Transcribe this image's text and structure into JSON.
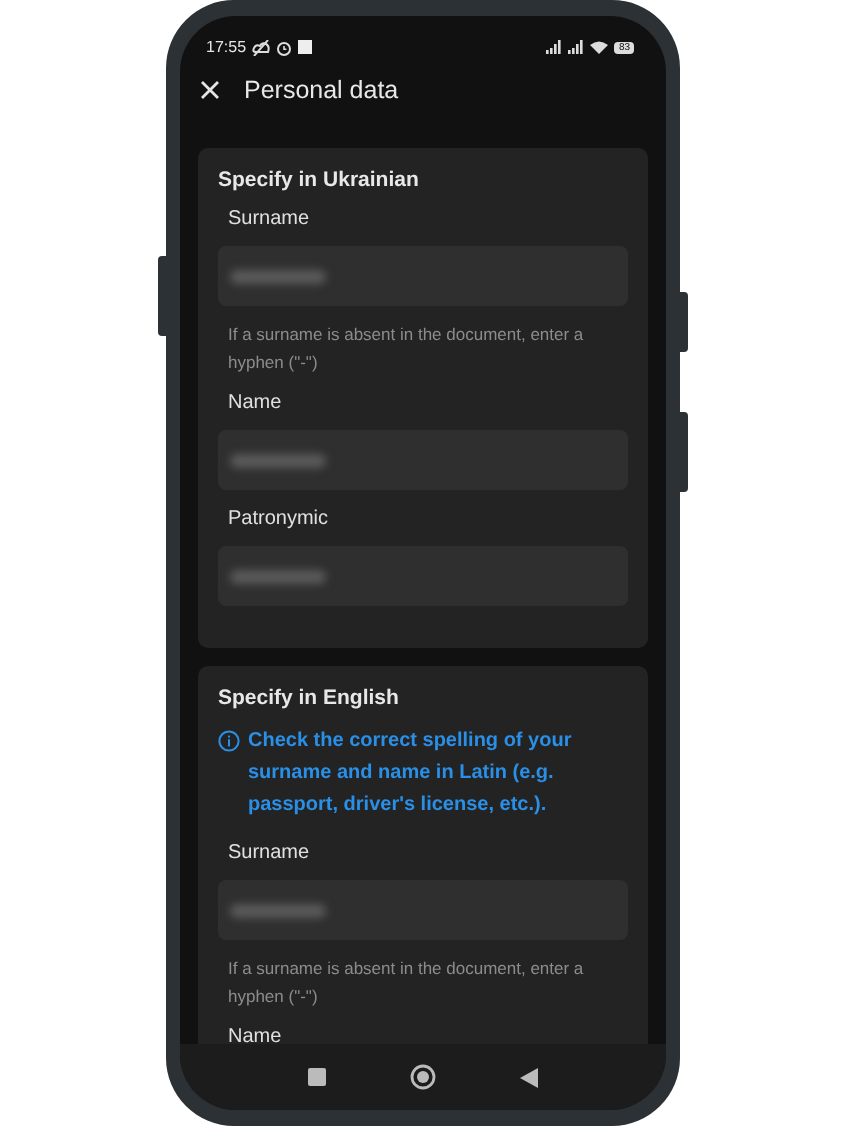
{
  "status_bar": {
    "time": "17:55",
    "battery": "83"
  },
  "header": {
    "title": "Personal data"
  },
  "sections": [
    {
      "title": "Specify in Ukrainian",
      "fields": [
        {
          "label": "Surname",
          "blurred": true,
          "hint": "If a surname is absent in the document, enter a hyphen (\"-\")"
        },
        {
          "label": "Name",
          "blurred": true
        },
        {
          "label": "Patronymic",
          "blurred": true
        }
      ]
    },
    {
      "title": "Specify in English",
      "info": "Check the correct spelling of your surname and name in Latin (e.g. passport, driver's license, etc.).",
      "fields": [
        {
          "label": "Surname",
          "blurred": true,
          "hint": "If a surname is absent in the document, enter a hyphen (\"-\")"
        },
        {
          "label": "Name"
        }
      ]
    }
  ]
}
